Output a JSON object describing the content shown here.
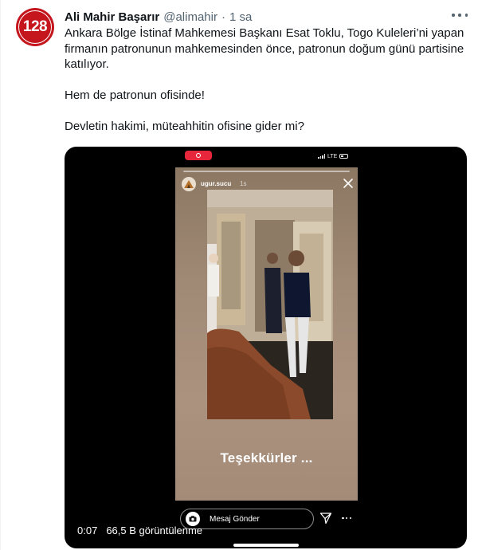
{
  "tweet": {
    "avatar_text": "128",
    "display_name": "Ali Mahir Başarır",
    "handle": "@alimahir",
    "separator": "·",
    "time": "1 sa",
    "paragraphs": [
      "Ankara Bölge İstinaf Mahkemesi Başkanı Esat Toklu, Togo Kuleleri’ni yapan firmanın patronunun mahkemesinden önce, patronun doğum günü partisine katılıyor.",
      "Hem de patronun ofisinde!",
      "Devletin hakimi, müteahhitin ofisine gider mi?"
    ]
  },
  "video": {
    "status_network": "LTE",
    "story_user": "ugur.sucu",
    "story_time": "1s",
    "caption": "Teşekkürler ...",
    "message_placeholder": "Mesaj Gönder",
    "elapsed": "0:07",
    "views": "66,5 B görüntülenme"
  },
  "colors": {
    "avatar_bg": "#c4161c",
    "secondary_text": "#536471",
    "media_bg": "#000000",
    "record_badge": "#e6263a"
  },
  "icons": [
    "more-icon",
    "record-icon",
    "signal-icon",
    "battery-icon",
    "close-icon",
    "camera-icon",
    "send-icon",
    "menu-dots-icon"
  ]
}
